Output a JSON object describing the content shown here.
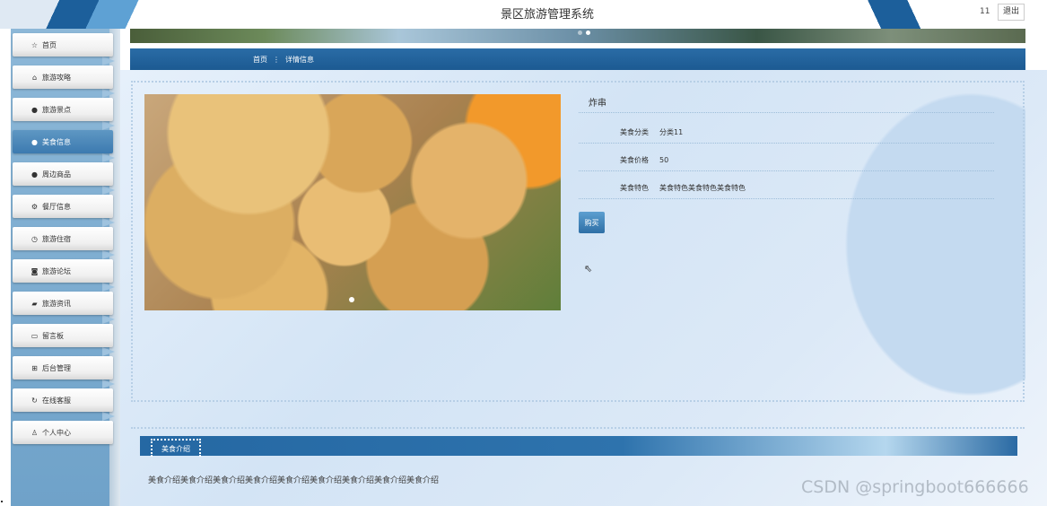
{
  "header": {
    "title": "景区旅游管理系统",
    "user": "11",
    "logout_label": "退出"
  },
  "sidebar": {
    "items": [
      {
        "label": "首页",
        "icon": "star-icon"
      },
      {
        "label": "旅游攻略",
        "icon": "house-icon"
      },
      {
        "label": "旅游景点",
        "icon": "info-icon"
      },
      {
        "label": "美食信息",
        "icon": "dot-icon",
        "active": true
      },
      {
        "label": "周边商品",
        "icon": "info-icon"
      },
      {
        "label": "餐厅信息",
        "icon": "settings-icon"
      },
      {
        "label": "旅游住宿",
        "icon": "clock-icon"
      },
      {
        "label": "旅游论坛",
        "icon": "camera-icon"
      },
      {
        "label": "旅游资讯",
        "icon": "car-icon"
      },
      {
        "label": "留言板",
        "icon": "video-icon"
      },
      {
        "label": "后台管理",
        "icon": "gift-icon"
      },
      {
        "label": "在线客服",
        "icon": "refresh-icon"
      },
      {
        "label": "个人中心",
        "icon": "user-icon"
      }
    ]
  },
  "breadcrumb": {
    "home": "首页",
    "sep": "⋮",
    "current": "详情信息"
  },
  "detail": {
    "name": "炸串",
    "fields": [
      {
        "key": "美食分类",
        "value": "分类11"
      },
      {
        "key": "美食价格",
        "value": "50"
      },
      {
        "key": "美食特色",
        "value": "美食特色美食特色美食特色"
      }
    ],
    "buy_label": "购买"
  },
  "intro": {
    "tab_label": "美食介绍",
    "text": "美食介绍美食介绍美食介绍美食介绍美食介绍美食介绍美食介绍美食介绍美食介绍"
  },
  "watermark": "CSDN @springboot666666",
  "colors": {
    "primary": "#1c5f9b",
    "active_nav": "#3c7ab0",
    "content_bg": "#dce9f7"
  }
}
